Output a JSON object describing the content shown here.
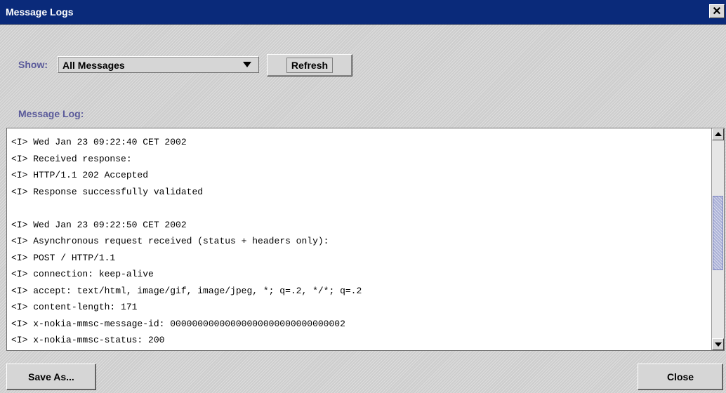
{
  "window": {
    "title": "Message Logs",
    "close_glyph": "✕",
    "colors": {
      "titlebar": "#0a2a7a",
      "label": "#5a5a9a",
      "scroll_thumb": "#aab0d6"
    }
  },
  "filter": {
    "label": "Show:",
    "selected": "All Messages",
    "refresh_label": "Refresh"
  },
  "log": {
    "label": "Message Log:",
    "lines": [
      "<I> Wed Jan 23 09:22:40 CET 2002",
      "<I> Received response:",
      "<I> HTTP/1.1 202 Accepted",
      "<I> Response successfully validated",
      "",
      "<I> Wed Jan 23 09:22:50 CET 2002",
      "<I> Asynchronous request received (status + headers only):",
      "<I> POST / HTTP/1.1",
      "<I> connection: keep-alive",
      "<I> accept: text/html, image/gif, image/jpeg, *; q=.2, */*; q=.2",
      "<I> content-length: 171",
      "<I> x-nokia-mmsc-message-id: 00000000000000000000000000000002",
      "<I> x-nokia-mmsc-status: 200"
    ]
  },
  "footer": {
    "save_label": "Save As...",
    "close_label": "Close"
  }
}
